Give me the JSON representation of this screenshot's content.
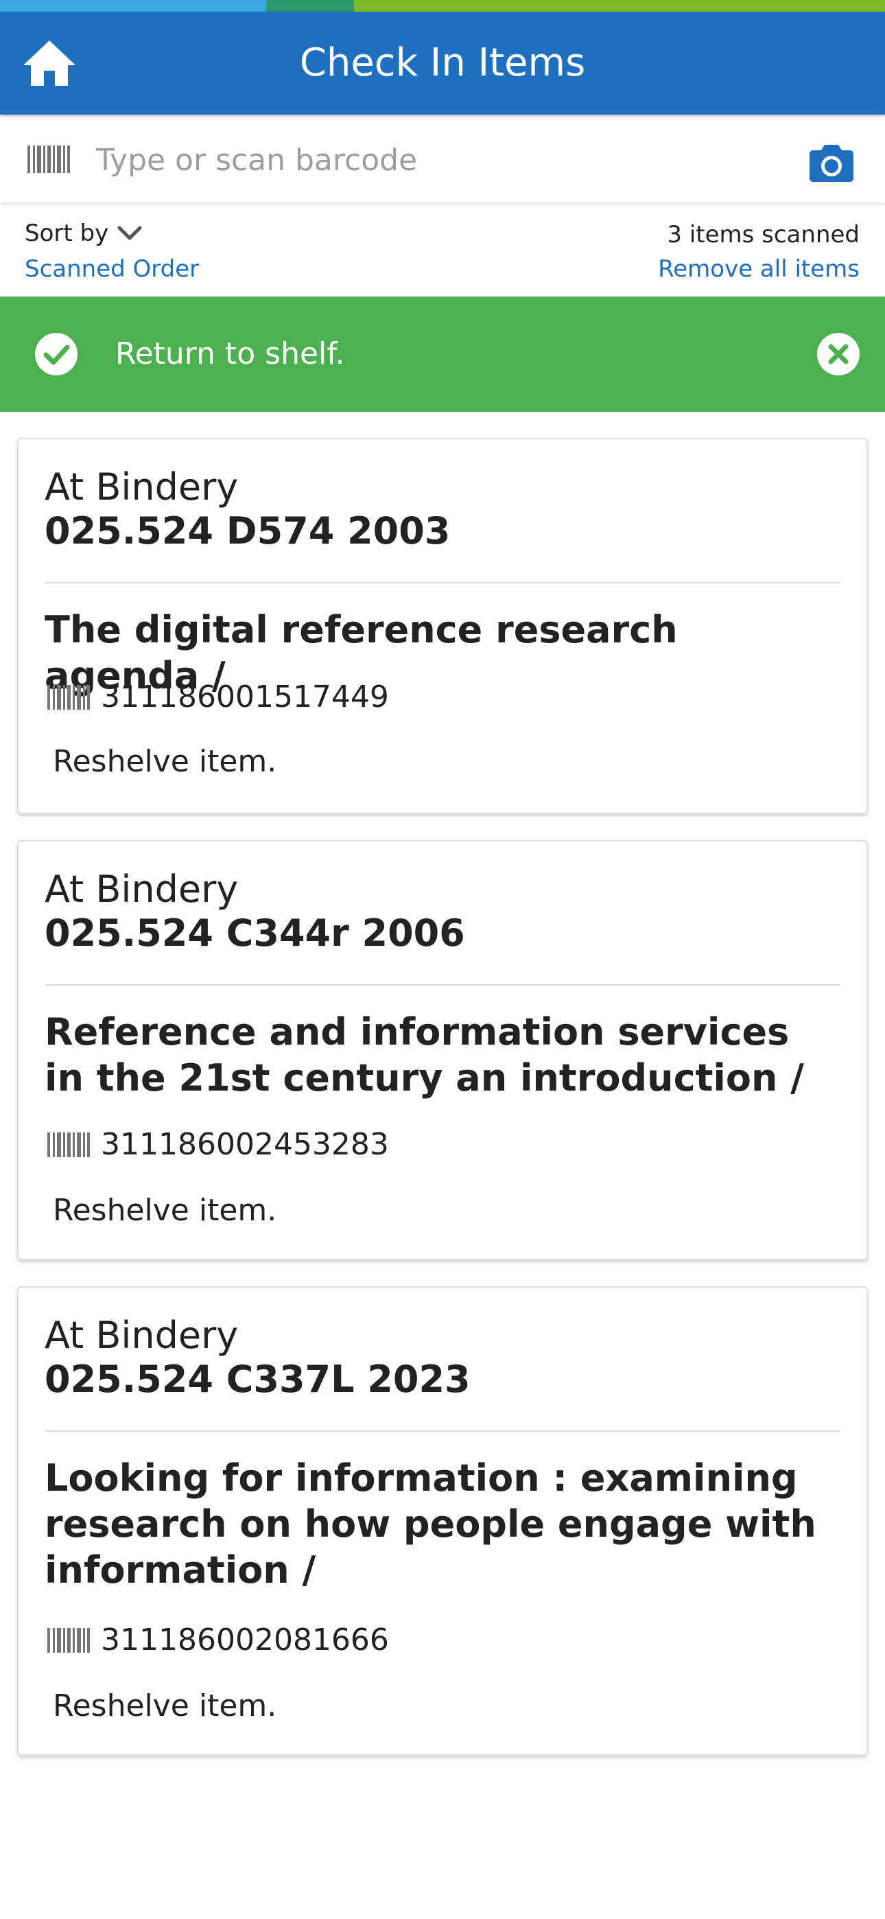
{
  "status_strip": {
    "colors": [
      "#39a9e0",
      "#2e9a6b",
      "#7dbb2a"
    ]
  },
  "header": {
    "title": "Check In Items",
    "home_icon": "home-icon",
    "background": "#1e6fbf"
  },
  "scan": {
    "placeholder": "Type or scan barcode",
    "value": "",
    "barcode_icon": "barcode-icon",
    "camera_icon": "camera-icon"
  },
  "sort": {
    "label": "Sort by",
    "value": "Scanned Order",
    "chevron_icon": "chevron-down-icon"
  },
  "summary": {
    "count_text": "3 items scanned",
    "remove_all_label": "Remove all items"
  },
  "banner": {
    "message": "Return to shelf.",
    "color": "#4caf50",
    "check_icon": "check-circle-icon",
    "close_icon": "close-circle-icon"
  },
  "items": [
    {
      "status": "At Bindery",
      "call_number": "025.524 D574 2003",
      "title": "The digital reference research agenda /",
      "barcode": "311186001517449",
      "action": "Reshelve item."
    },
    {
      "status": "At Bindery",
      "call_number": "025.524 C344r 2006",
      "title": "Reference and information services in the 21st century an introduction /",
      "barcode": "311186002453283",
      "action": "Reshelve item."
    },
    {
      "status": "At Bindery",
      "call_number": "025.524 C337L 2023",
      "title": "Looking for information : examining research on how people engage with information /",
      "barcode": "311186002081666",
      "action": "Reshelve item."
    }
  ]
}
